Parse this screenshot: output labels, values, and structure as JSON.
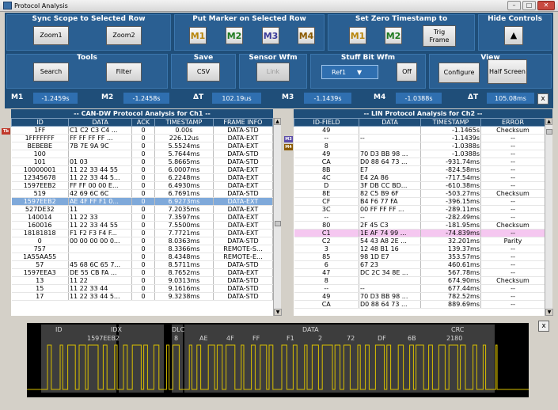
{
  "window": {
    "title": "Protocol Analysis"
  },
  "controls": {
    "sync": {
      "title": "Sync Scope to Selected Row",
      "zoom1": "Zoom1",
      "zoom2": "Zoom2"
    },
    "marker": {
      "title": "Put Marker on Selected Row",
      "m1": "M1",
      "m2": "M2",
      "m3": "M3",
      "m4": "M4"
    },
    "zero": {
      "title": "Set Zero Timestamp to",
      "m1": "M1",
      "m2": "M2",
      "trig": "Trig Frame"
    },
    "hide": {
      "title": "Hide Controls",
      "glyph": "▲"
    },
    "tools": {
      "title": "Tools",
      "search": "Search",
      "filter": "Filter"
    },
    "save": {
      "title": "Save",
      "csv": "CSV"
    },
    "sensor": {
      "title": "Sensor Wfm",
      "link": "Link"
    },
    "stuff": {
      "title": "Stuff Bit Wfm",
      "ref": "Ref1",
      "off": "Off"
    },
    "view": {
      "title": "View",
      "configure": "Configure",
      "half": "Half Screen"
    }
  },
  "measure": {
    "m1_label": "M1",
    "m1": "-1.2459s",
    "m2_label": "M2",
    "m2": "-1.2458s",
    "dt_label": "ΔT",
    "dt": "102.19us",
    "m3_label": "M3",
    "m3": "-1.1439s",
    "m4_label": "M4",
    "m4": "-1.0388s",
    "dt2_label": "ΔT",
    "dt2": "105.08ms",
    "close": "x"
  },
  "can": {
    "title": "-- CAN-DW Protocol Analysis for Ch1 --",
    "columns": [
      "ID",
      "DATA",
      "ACK",
      "TIMESTAMP",
      "FRAME INFO"
    ],
    "rows": [
      [
        "1FF",
        "C1 C2 C3 C4 ...",
        "0",
        "0.00s",
        "DATA-STD"
      ],
      [
        "1FFFFFFF",
        "FF FF FF FF ...",
        "0",
        "226.12us",
        "DATA-EXT"
      ],
      [
        "BEBEBE",
        "7B 7E 9A 9C",
        "0",
        "5.5524ms",
        "DATA-EXT"
      ],
      [
        "100",
        "",
        "0",
        "5.7644ms",
        "DATA-STD"
      ],
      [
        "101",
        "01 03",
        "0",
        "5.8665ms",
        "DATA-STD"
      ],
      [
        "10000001",
        "11 22 33 44 55",
        "0",
        "6.0007ms",
        "DATA-EXT"
      ],
      [
        "12345678",
        "11 22 33 44 5...",
        "0",
        "6.2248ms",
        "DATA-EXT"
      ],
      [
        "1597EEB2",
        "FF FF 00 00 E...",
        "0",
        "6.4930ms",
        "DATA-EXT"
      ],
      [
        "519",
        "42 69 6C 6C",
        "0",
        "6.7691ms",
        "DATA-STD"
      ],
      [
        "1597EEB2",
        "AE 4F FF F1 0...",
        "0",
        "6.9273ms",
        "DATA-EXT"
      ],
      [
        "527DE32",
        "11",
        "0",
        "7.2035ms",
        "DATA-EXT"
      ],
      [
        "140014",
        "11 22 33",
        "0",
        "7.3597ms",
        "DATA-EXT"
      ],
      [
        "160016",
        "11 22 33 44 55",
        "0",
        "7.5500ms",
        "DATA-EXT"
      ],
      [
        "18181818",
        "F1 F2 F3 F4 F...",
        "0",
        "7.7721ms",
        "DATA-EXT"
      ],
      [
        "0",
        "00 00 00 00 0...",
        "0",
        "8.0363ms",
        "DATA-STD"
      ],
      [
        "757",
        "",
        "0",
        "8.3366ms",
        "REMOTE-S..."
      ],
      [
        "1A55AA55",
        "",
        "0",
        "8.4348ms",
        "REMOTE-E..."
      ],
      [
        "57",
        "45 68 6C 65 7...",
        "0",
        "8.5711ms",
        "DATA-STD"
      ],
      [
        "1597EEA3",
        "DE 55 CB FA ...",
        "0",
        "8.7652ms",
        "DATA-EXT"
      ],
      [
        "13",
        "11 22",
        "0",
        "9.0313ms",
        "DATA-STD"
      ],
      [
        "15",
        "11 22 33 44",
        "0",
        "9.1616ms",
        "DATA-STD"
      ],
      [
        "17",
        "11 22 33 44 5...",
        "0",
        "9.3238ms",
        "DATA-STD"
      ]
    ],
    "selected": 9,
    "side_marker": "Tb"
  },
  "lin": {
    "title": "-- LIN Protocol Analysis for Ch2 --",
    "columns": [
      "ID-FIELD",
      "DATA",
      "TIMESTAMP",
      "ERROR"
    ],
    "rows": [
      [
        "49",
        "",
        "-1.1465s",
        "Checksum"
      ],
      [
        "--",
        "--",
        "-1.1439s",
        "--"
      ],
      [
        "8",
        "",
        "-1.0388s",
        "--"
      ],
      [
        "49",
        "70 D3 BB 98 ...",
        "-1.0388s",
        "--"
      ],
      [
        "CA",
        "D0 88 64 73 ...",
        "-931.74ms",
        "--"
      ],
      [
        "8B",
        "E7",
        "-824.58ms",
        "--"
      ],
      [
        "4C",
        "E4 2A 86",
        "-717.54ms",
        "--"
      ],
      [
        "D",
        "3F DB CC BD...",
        "-610.38ms",
        "--"
      ],
      [
        "8E",
        "82 C5 B9 6F",
        "-503.27ms",
        "Checksum"
      ],
      [
        "CF",
        "B4 F6 77 FA",
        "-396.15ms",
        "--"
      ],
      [
        "3C",
        "00 FF FF FF ...",
        "-289.11ms",
        "--"
      ],
      [
        "--",
        "--",
        "-282.49ms",
        "--"
      ],
      [
        "80",
        "2F 45 C3",
        "-181.95ms",
        "Checksum"
      ],
      [
        "C1",
        "1E AF 74 99 ...",
        "-74.839ms",
        "--"
      ],
      [
        "C2",
        "54 43 A8 2E ...",
        "32.201ms",
        "Parity"
      ],
      [
        "3",
        "12 48 B1 16",
        "139.37ms",
        "--"
      ],
      [
        "85",
        "98 1D E7",
        "353.57ms",
        "--"
      ],
      [
        "6",
        "67 23",
        "460.61ms",
        "--"
      ],
      [
        "47",
        "DC 2C 34 8E ...",
        "567.78ms",
        "--"
      ],
      [
        "8",
        "",
        "674.90ms",
        "Checksum"
      ],
      [
        "--",
        "--",
        "677.44ms",
        "--"
      ],
      [
        "49",
        "70 D3 BB 98 ...",
        "782.52ms",
        "--"
      ],
      [
        "CA",
        "D0 88 64 73 ...",
        "889.69ms",
        "--"
      ]
    ],
    "highlighted": 13,
    "side_markers": [
      "M3",
      "M4"
    ]
  },
  "waveform": {
    "segments": [
      {
        "label": "ID"
      },
      {
        "label": "IDX",
        "sublabel": "1597EEB2"
      },
      {
        "label": "DLC",
        "sublabel": "8"
      },
      {
        "label": "DATA",
        "bytes": [
          "AE",
          "4F",
          "FF",
          "F1",
          "2",
          "72",
          "DF",
          "6B"
        ]
      },
      {
        "label": "CRC",
        "sublabel": "2180"
      }
    ],
    "close": "x"
  },
  "colors": {
    "panel": "#1f4e79",
    "group": "#2a5f92",
    "value": "#2f6fb0",
    "selected": "#7fa9da",
    "highlight": "#f5c7f0",
    "wave": "#d9c000",
    "segment": "#3d3d3d"
  }
}
